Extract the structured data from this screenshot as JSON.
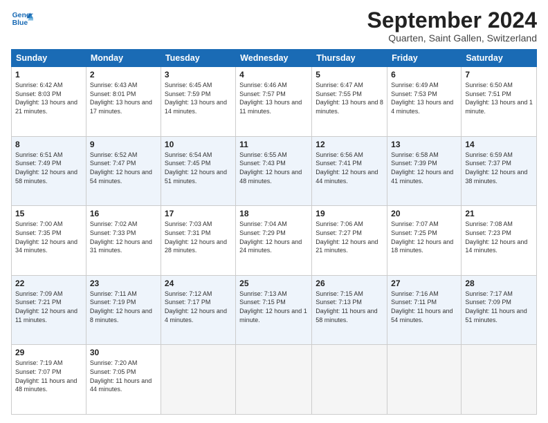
{
  "logo": {
    "line1": "General",
    "line2": "Blue"
  },
  "title": "September 2024",
  "location": "Quarten, Saint Gallen, Switzerland",
  "days_of_week": [
    "Sunday",
    "Monday",
    "Tuesday",
    "Wednesday",
    "Thursday",
    "Friday",
    "Saturday"
  ],
  "weeks": [
    [
      {
        "day": "1",
        "sunrise": "6:42 AM",
        "sunset": "8:03 PM",
        "daylight": "13 hours and 21 minutes."
      },
      {
        "day": "2",
        "sunrise": "6:43 AM",
        "sunset": "8:01 PM",
        "daylight": "13 hours and 17 minutes."
      },
      {
        "day": "3",
        "sunrise": "6:45 AM",
        "sunset": "7:59 PM",
        "daylight": "13 hours and 14 minutes."
      },
      {
        "day": "4",
        "sunrise": "6:46 AM",
        "sunset": "7:57 PM",
        "daylight": "13 hours and 11 minutes."
      },
      {
        "day": "5",
        "sunrise": "6:47 AM",
        "sunset": "7:55 PM",
        "daylight": "13 hours and 8 minutes."
      },
      {
        "day": "6",
        "sunrise": "6:49 AM",
        "sunset": "7:53 PM",
        "daylight": "13 hours and 4 minutes."
      },
      {
        "day": "7",
        "sunrise": "6:50 AM",
        "sunset": "7:51 PM",
        "daylight": "13 hours and 1 minute."
      }
    ],
    [
      {
        "day": "8",
        "sunrise": "6:51 AM",
        "sunset": "7:49 PM",
        "daylight": "12 hours and 58 minutes."
      },
      {
        "day": "9",
        "sunrise": "6:52 AM",
        "sunset": "7:47 PM",
        "daylight": "12 hours and 54 minutes."
      },
      {
        "day": "10",
        "sunrise": "6:54 AM",
        "sunset": "7:45 PM",
        "daylight": "12 hours and 51 minutes."
      },
      {
        "day": "11",
        "sunrise": "6:55 AM",
        "sunset": "7:43 PM",
        "daylight": "12 hours and 48 minutes."
      },
      {
        "day": "12",
        "sunrise": "6:56 AM",
        "sunset": "7:41 PM",
        "daylight": "12 hours and 44 minutes."
      },
      {
        "day": "13",
        "sunrise": "6:58 AM",
        "sunset": "7:39 PM",
        "daylight": "12 hours and 41 minutes."
      },
      {
        "day": "14",
        "sunrise": "6:59 AM",
        "sunset": "7:37 PM",
        "daylight": "12 hours and 38 minutes."
      }
    ],
    [
      {
        "day": "15",
        "sunrise": "7:00 AM",
        "sunset": "7:35 PM",
        "daylight": "12 hours and 34 minutes."
      },
      {
        "day": "16",
        "sunrise": "7:02 AM",
        "sunset": "7:33 PM",
        "daylight": "12 hours and 31 minutes."
      },
      {
        "day": "17",
        "sunrise": "7:03 AM",
        "sunset": "7:31 PM",
        "daylight": "12 hours and 28 minutes."
      },
      {
        "day": "18",
        "sunrise": "7:04 AM",
        "sunset": "7:29 PM",
        "daylight": "12 hours and 24 minutes."
      },
      {
        "day": "19",
        "sunrise": "7:06 AM",
        "sunset": "7:27 PM",
        "daylight": "12 hours and 21 minutes."
      },
      {
        "day": "20",
        "sunrise": "7:07 AM",
        "sunset": "7:25 PM",
        "daylight": "12 hours and 18 minutes."
      },
      {
        "day": "21",
        "sunrise": "7:08 AM",
        "sunset": "7:23 PM",
        "daylight": "12 hours and 14 minutes."
      }
    ],
    [
      {
        "day": "22",
        "sunrise": "7:09 AM",
        "sunset": "7:21 PM",
        "daylight": "12 hours and 11 minutes."
      },
      {
        "day": "23",
        "sunrise": "7:11 AM",
        "sunset": "7:19 PM",
        "daylight": "12 hours and 8 minutes."
      },
      {
        "day": "24",
        "sunrise": "7:12 AM",
        "sunset": "7:17 PM",
        "daylight": "12 hours and 4 minutes."
      },
      {
        "day": "25",
        "sunrise": "7:13 AM",
        "sunset": "7:15 PM",
        "daylight": "12 hours and 1 minute."
      },
      {
        "day": "26",
        "sunrise": "7:15 AM",
        "sunset": "7:13 PM",
        "daylight": "11 hours and 58 minutes."
      },
      {
        "day": "27",
        "sunrise": "7:16 AM",
        "sunset": "7:11 PM",
        "daylight": "11 hours and 54 minutes."
      },
      {
        "day": "28",
        "sunrise": "7:17 AM",
        "sunset": "7:09 PM",
        "daylight": "11 hours and 51 minutes."
      }
    ],
    [
      {
        "day": "29",
        "sunrise": "7:19 AM",
        "sunset": "7:07 PM",
        "daylight": "11 hours and 48 minutes."
      },
      {
        "day": "30",
        "sunrise": "7:20 AM",
        "sunset": "7:05 PM",
        "daylight": "11 hours and 44 minutes."
      },
      null,
      null,
      null,
      null,
      null
    ]
  ]
}
